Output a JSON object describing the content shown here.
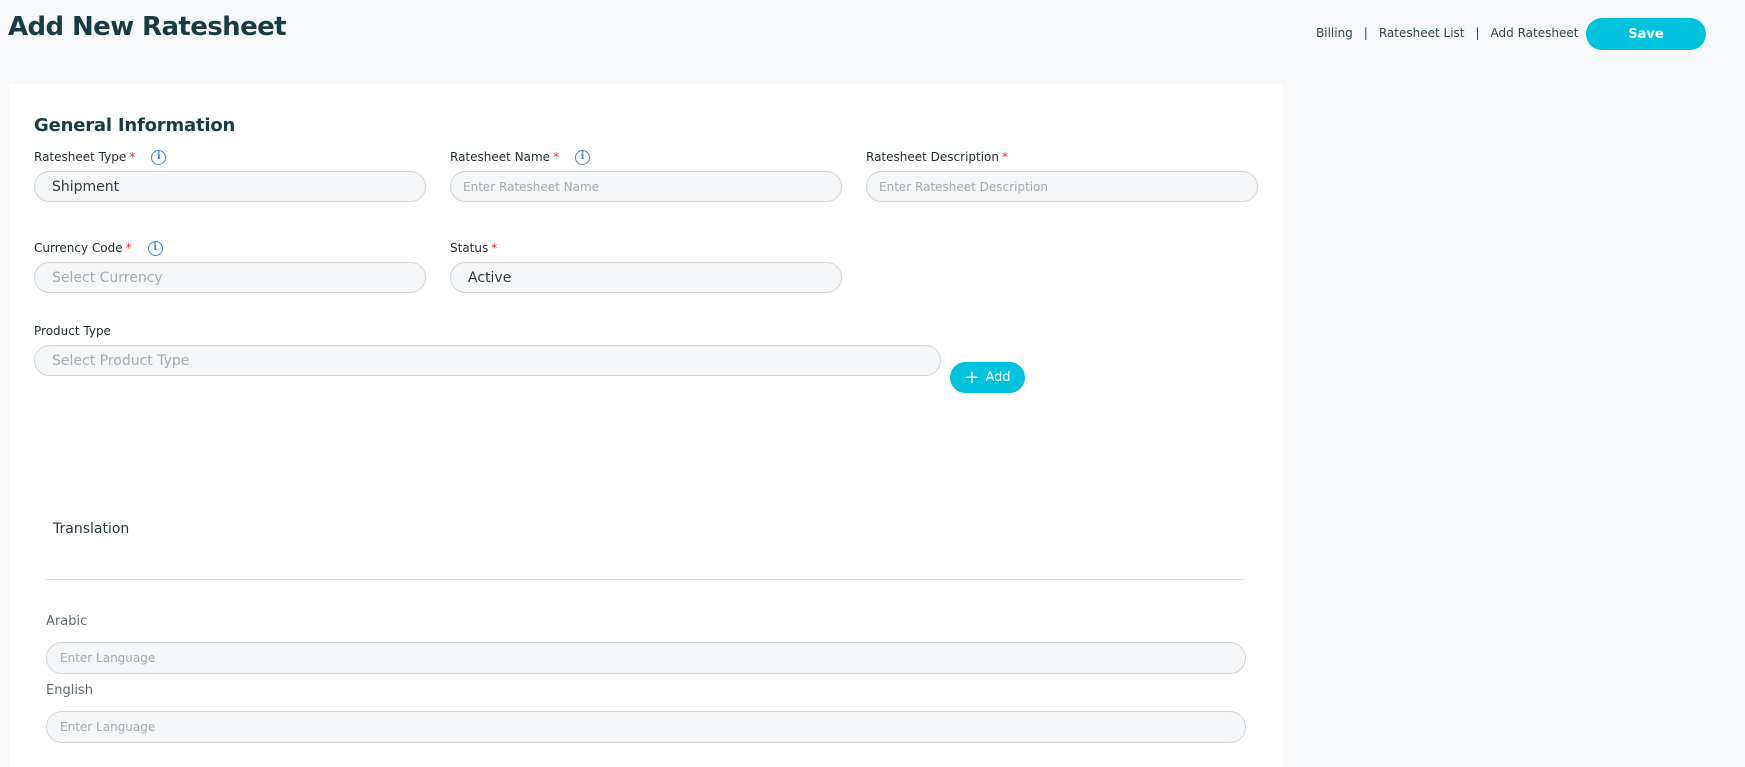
{
  "header": {
    "title": "Add New Ratesheet",
    "breadcrumb": [
      "Billing",
      "Ratesheet List",
      "Add Ratesheet"
    ],
    "save_label": "Save"
  },
  "general": {
    "title": "General Information",
    "ratesheet_type": {
      "label": "Ratesheet Type",
      "value": "Shipment"
    },
    "ratesheet_name": {
      "label": "Ratesheet Name",
      "placeholder": "Enter Ratesheet Name"
    },
    "ratesheet_description": {
      "label": "Ratesheet Description",
      "placeholder": "Enter Ratesheet Description"
    },
    "currency_code": {
      "label": "Currency Code",
      "placeholder": "Select Currency"
    },
    "status": {
      "label": "Status",
      "value": "Active"
    },
    "product_type": {
      "label": "Product Type",
      "placeholder": "Select Product Type",
      "add_label": "Add"
    },
    "required_mark": "*",
    "info_glyph": "i"
  },
  "translation": {
    "title": "Translation",
    "languages": [
      {
        "label": "Arabic",
        "placeholder": "Enter Language"
      },
      {
        "label": "English",
        "placeholder": "Enter Language"
      }
    ]
  },
  "colors": {
    "accent": "#00c2dd",
    "required": "#e22d2d",
    "info": "#3f85d6"
  }
}
